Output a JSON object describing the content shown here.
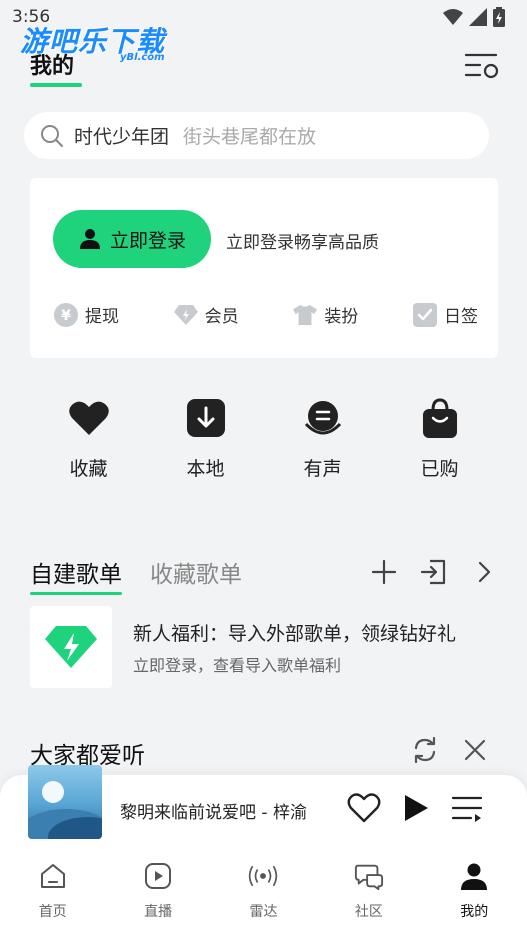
{
  "status": {
    "time": "3:56"
  },
  "watermark": {
    "main": "游吧乐下载",
    "sub": "yBl.com"
  },
  "header": {
    "title": "我的"
  },
  "search": {
    "hot_keyword": "时代少年团",
    "suggestion": "街头巷尾都在放"
  },
  "login_card": {
    "login_label": "立即登录",
    "hint": "立即登录畅享高品质",
    "perks": [
      {
        "label": "提现",
        "icon": "yuan-coin-icon"
      },
      {
        "label": "会员",
        "icon": "diamond-icon"
      },
      {
        "label": "装扮",
        "icon": "tshirt-icon"
      },
      {
        "label": "日签",
        "icon": "checkbox-icon"
      }
    ]
  },
  "quick": [
    {
      "label": "收藏",
      "icon": "heart-icon"
    },
    {
      "label": "本地",
      "icon": "download-icon"
    },
    {
      "label": "有声",
      "icon": "microphone-icon"
    },
    {
      "label": "已购",
      "icon": "shopping-bag-icon"
    }
  ],
  "playlist_tabs": {
    "active": "自建歌单",
    "other": "收藏歌单"
  },
  "import_card": {
    "title": "新人福利：导入外部歌单，领绿钻好礼",
    "subtitle": "立即登录，查看导入歌单福利"
  },
  "everyone": {
    "title": "大家都爱听"
  },
  "player": {
    "song": "黎明来临前说爱吧 - 梓渝"
  },
  "nav": [
    {
      "label": "首页",
      "icon": "home-icon"
    },
    {
      "label": "直播",
      "icon": "play-box-icon"
    },
    {
      "label": "雷达",
      "icon": "radar-icon"
    },
    {
      "label": "社区",
      "icon": "chat-bubbles-icon"
    },
    {
      "label": "我的",
      "icon": "person-icon",
      "active": true
    }
  ],
  "colors": {
    "accent": "#1ed37c",
    "background": "#f2f3f5"
  }
}
